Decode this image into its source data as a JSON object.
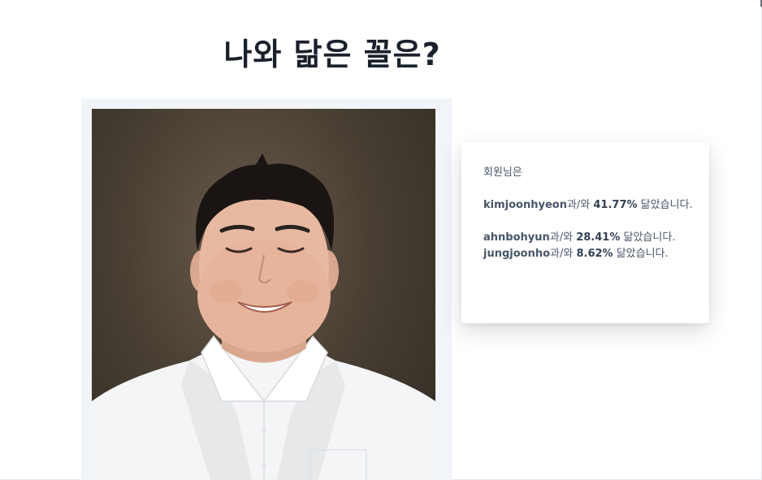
{
  "page": {
    "title": "나와 닮은 꼴은?"
  },
  "result": {
    "intro": "회원님은",
    "matches": [
      {
        "name": "kimjoonhyeon",
        "particle": "과/와 ",
        "percent": "41.77%",
        "suffix": " 닮았습니다."
      },
      {
        "name": "ahnbohyun",
        "particle": "과/와 ",
        "percent": "28.41%",
        "suffix": " 닮았습니다."
      },
      {
        "name": "jungjoonho",
        "particle": "과/와 ",
        "percent": "8.62%",
        "suffix": " 닮았습니다."
      }
    ]
  },
  "colors": {
    "title": "#1a202c",
    "text": "#4a5568",
    "frame": "#f1f4f8",
    "shirt": "#f4f5f6"
  },
  "photo": {
    "icon": "uploaded-face-photo"
  }
}
